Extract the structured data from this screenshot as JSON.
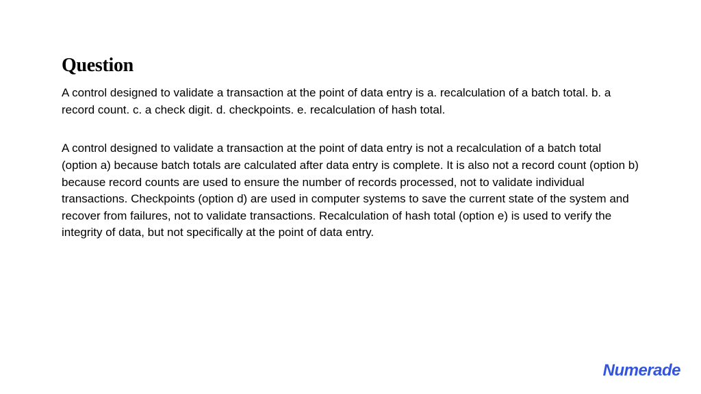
{
  "heading": "Question",
  "question": "A control designed to validate a transaction at the point of data entry is a. recalculation of a batch total. b. a record count. c. a check digit. d. checkpoints. e. recalculation of hash total.",
  "answer": "A control designed to validate a transaction at the point of data entry is not a recalculation of a batch total (option a) because batch totals are calculated after data entry is complete. It is also not a record count (option b) because record counts are used to ensure the number of records processed, not to validate individual transactions. Checkpoints (option d) are used in computer systems to save the current state of the system and recover from failures, not to validate transactions. Recalculation of hash total (option e) is used to verify the integrity of data, but not specifically at the point of data entry.",
  "brand": "Numerade"
}
